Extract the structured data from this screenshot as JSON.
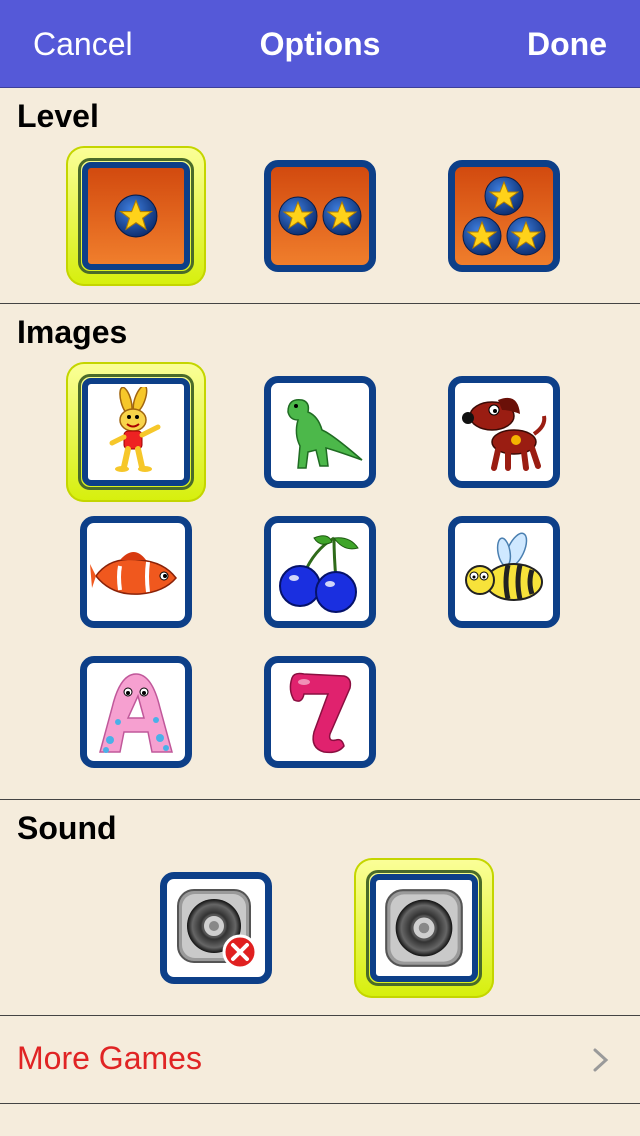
{
  "navbar": {
    "cancel_label": "Cancel",
    "title": "Options",
    "done_label": "Done"
  },
  "level": {
    "title": "Level",
    "options": [
      {
        "stars": 1,
        "selected": true
      },
      {
        "stars": 2,
        "selected": false
      },
      {
        "stars": 3,
        "selected": false
      }
    ]
  },
  "images": {
    "title": "Images",
    "options": [
      {
        "icon": "rabbit-icon",
        "selected": true
      },
      {
        "icon": "dinosaur-icon",
        "selected": false
      },
      {
        "icon": "dog-icon",
        "selected": false
      },
      {
        "icon": "fish-icon",
        "selected": false
      },
      {
        "icon": "cherries-icon",
        "selected": false
      },
      {
        "icon": "bee-icon",
        "selected": false
      },
      {
        "icon": "letter-a-icon",
        "selected": false
      },
      {
        "icon": "number-seven-icon",
        "selected": false
      }
    ]
  },
  "sound": {
    "title": "Sound",
    "options": [
      {
        "icon": "speaker-muted-icon",
        "selected": false
      },
      {
        "icon": "speaker-icon",
        "selected": true
      }
    ]
  },
  "more_games": {
    "label": "More Games",
    "icon": "chevron-right-icon"
  },
  "colors": {
    "navbar": "#5559d8",
    "tile_border": "#0d3f88",
    "selected_glow": "#e5f52a",
    "link": "#e02424",
    "background": "#f5ecdc"
  }
}
